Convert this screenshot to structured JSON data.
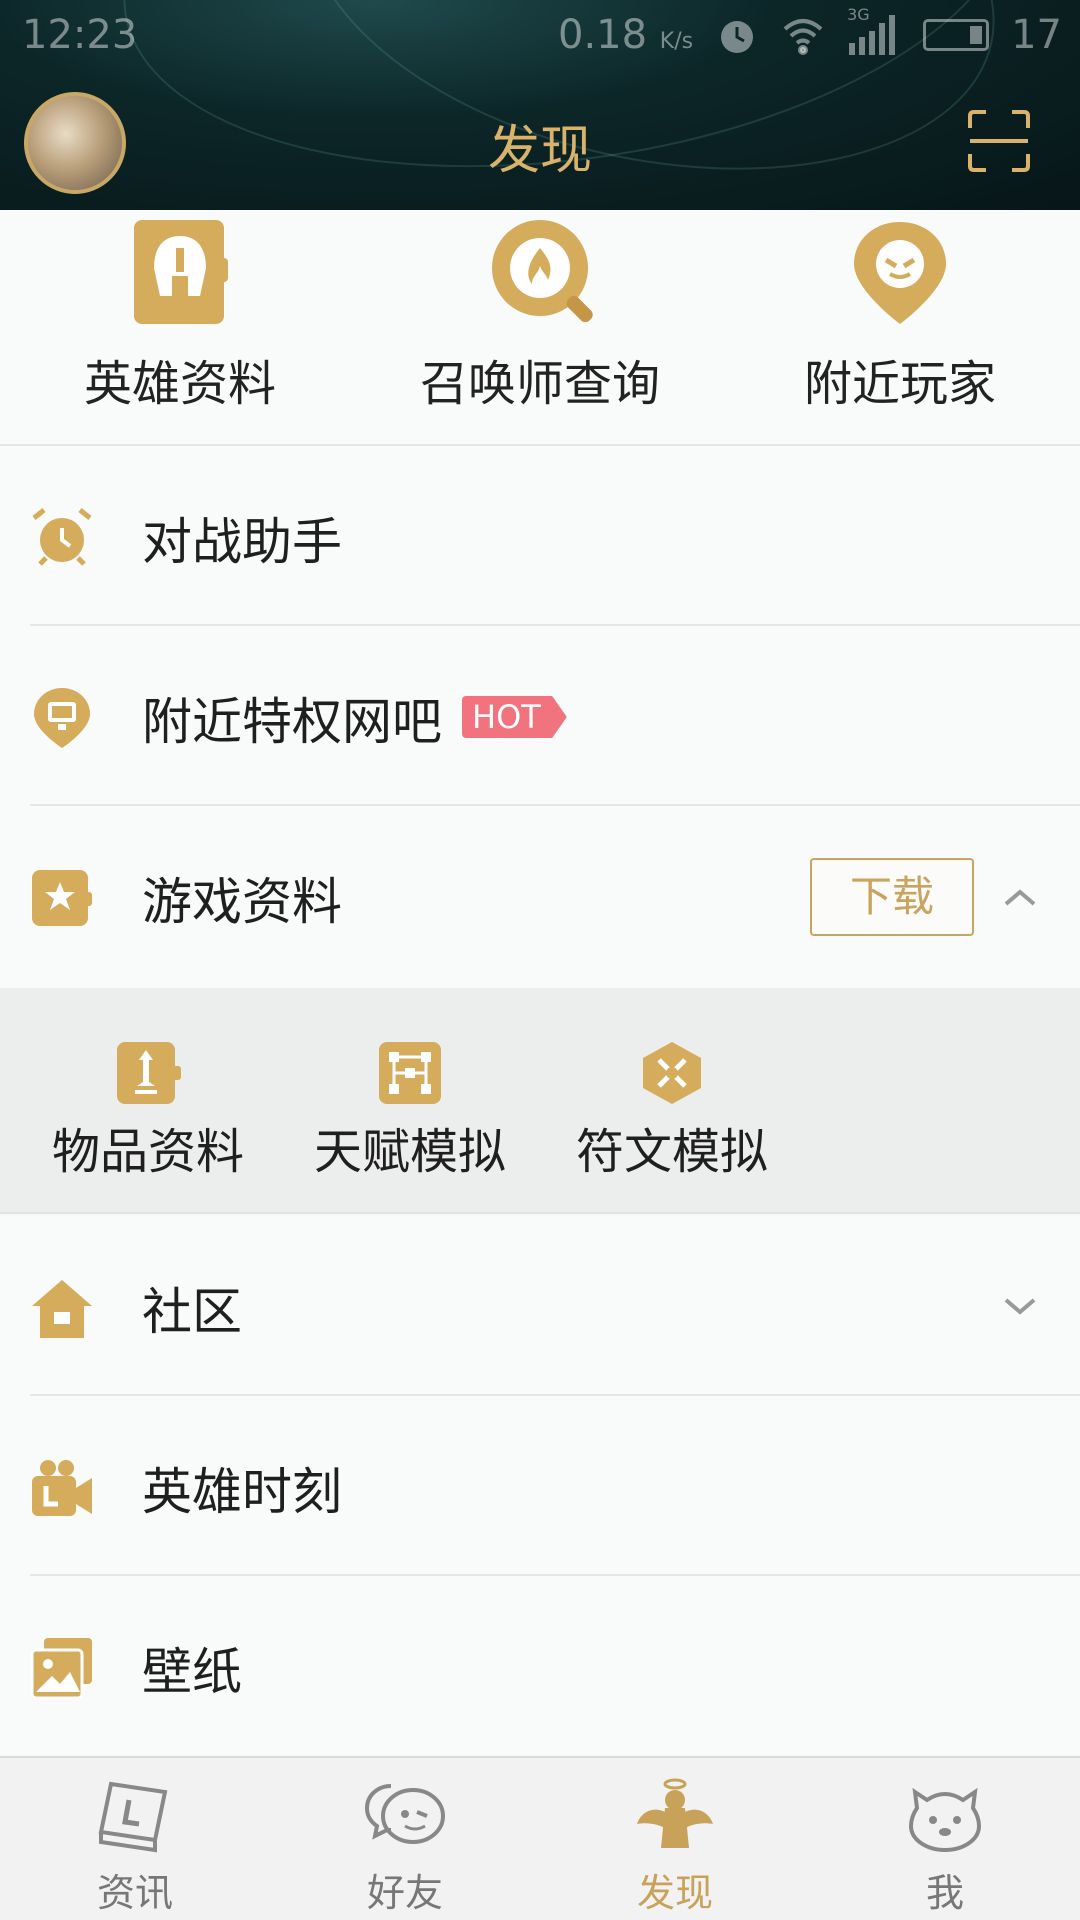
{
  "status_bar": {
    "time": "12:23",
    "net_speed": "0.18",
    "net_unit": "K/s",
    "network_type": "3G",
    "battery_level": "17"
  },
  "header": {
    "title": "发现"
  },
  "quick_grid": [
    {
      "label": "英雄资料",
      "icon": "helmet-icon"
    },
    {
      "label": "召唤师查询",
      "icon": "summoner-search-icon"
    },
    {
      "label": "附近玩家",
      "icon": "nearby-player-icon"
    }
  ],
  "list": {
    "battle_assistant": "对战助手",
    "nearby_netcafe": "附近特权网吧",
    "hot_badge": "HOT",
    "game_data": "游戏资料",
    "download_label": "下载",
    "community": "社区",
    "hero_moments": "英雄时刻",
    "wallpaper": "壁纸"
  },
  "sub_grid": [
    {
      "label": "物品资料",
      "icon": "item-data-icon"
    },
    {
      "label": "天赋模拟",
      "icon": "talent-tree-icon"
    },
    {
      "label": "符文模拟",
      "icon": "rune-icon"
    }
  ],
  "tabs": [
    {
      "label": "资讯",
      "icon": "news-book-icon"
    },
    {
      "label": "好友",
      "icon": "friends-chat-icon"
    },
    {
      "label": "发现",
      "icon": "discover-angel-icon",
      "active": true
    },
    {
      "label": "我",
      "icon": "me-face-icon"
    }
  ],
  "colors": {
    "accent_gold": "#c9a25a",
    "hot_badge": "#f0737e",
    "header_bg": "#0c2628"
  }
}
